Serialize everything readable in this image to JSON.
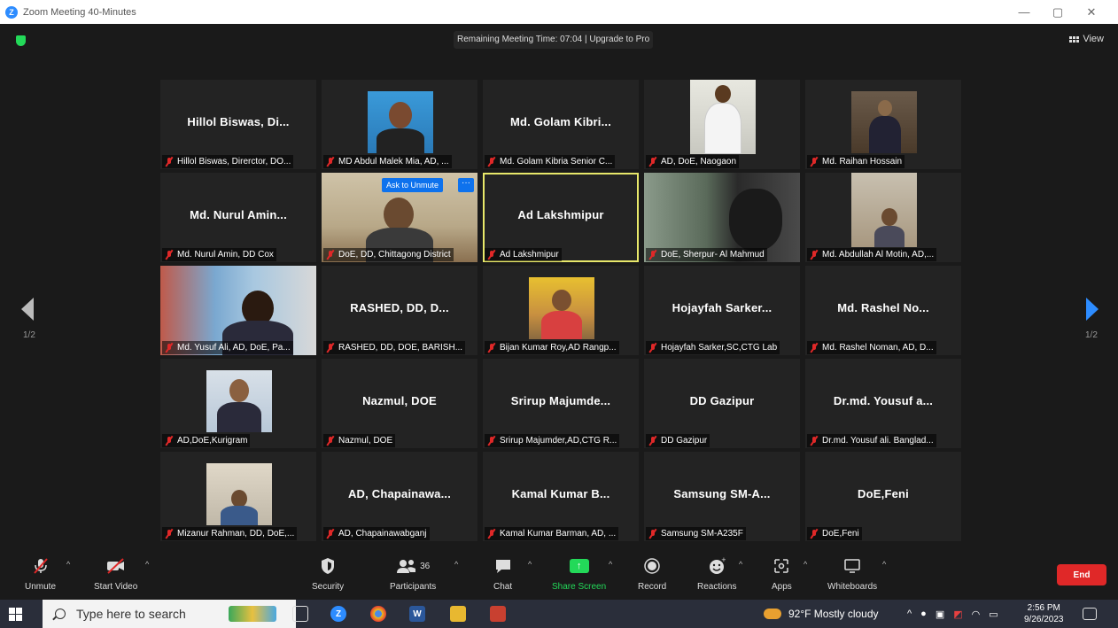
{
  "window": {
    "title": "Zoom Meeting 40-Minutes",
    "minimize": "—",
    "restore": "▢",
    "close": "✕"
  },
  "meeting": {
    "remaining": "Remaining Meeting Time: 07:04 | Upgrade to Pro",
    "view_label": "View",
    "page_left": "1/2",
    "page_right": "1/2",
    "ask_unmute": "Ask to Unmute",
    "more": "···"
  },
  "tiles": [
    {
      "big": "Hillol  Biswas,  Di...",
      "label": "Hillol Biswas, Direrctor, DO..."
    },
    {
      "big": "",
      "label": "MD Abdul Malek Mia, AD, ..."
    },
    {
      "big": "Md.  Golam  Kibri...",
      "label": "Md. Golam Kibria Senior C..."
    },
    {
      "big": "",
      "label": "AD, DoE, Naogaon"
    },
    {
      "big": "",
      "label": "Md. Raihan Hossain"
    },
    {
      "big": "Md.  Nurul  Amin...",
      "label": "Md. Nurul Amin, DD Cox"
    },
    {
      "big": "",
      "label": "DoE, DD, Chittagong District"
    },
    {
      "big": "Ad Lakshmipur",
      "label": "Ad Lakshmipur"
    },
    {
      "big": "",
      "label": "DoE, Sherpur- Al Mahmud"
    },
    {
      "big": "",
      "label": "Md. Abdullah Al Motin, AD,..."
    },
    {
      "big": "",
      "label": "Md. Yusuf Ali, AD, DoE, Pa..."
    },
    {
      "big": "RASHED,  DD,  D...",
      "label": "RASHED, DD, DOE, BARISH..."
    },
    {
      "big": "",
      "label": "Bijan Kumar Roy,AD Rangp..."
    },
    {
      "big": "Hojayfah  Sarker...",
      "label": "Hojayfah Sarker,SC,CTG Lab"
    },
    {
      "big": "Md.  Rashel  No...",
      "label": "Md. Rashel Noman, AD, D..."
    },
    {
      "big": "",
      "label": "AD,DoE,Kurigram"
    },
    {
      "big": "Nazmul,  DOE",
      "label": "Nazmul, DOE"
    },
    {
      "big": "Srirup  Majumde...",
      "label": "Srirup Majumder,AD,CTG R..."
    },
    {
      "big": "DD  Gazipur",
      "label": "DD Gazipur"
    },
    {
      "big": "Dr.md.  Yousuf  a...",
      "label": "Dr.md. Yousuf ali.  Banglad..."
    },
    {
      "big": "",
      "label": "Mizanur Rahman, DD, DoE,..."
    },
    {
      "big": "AD,  Chapainawa...",
      "label": "AD, Chapainawabganj"
    },
    {
      "big": "Kamal  Kumar  B...",
      "label": "Kamal Kumar Barman, AD, ..."
    },
    {
      "big": "Samsung  SM-A...",
      "label": "Samsung SM-A235F"
    },
    {
      "big": "DoE,Feni",
      "label": "DoE,Feni"
    }
  ],
  "toolbar": {
    "unmute": "Unmute",
    "start_video": "Start Video",
    "security": "Security",
    "participants": "Participants",
    "participants_count": "36",
    "chat": "Chat",
    "share_screen": "Share Screen",
    "record": "Record",
    "reactions": "Reactions",
    "apps": "Apps",
    "whiteboards": "Whiteboards",
    "end": "End",
    "caret": "^"
  },
  "taskbar": {
    "search_placeholder": "Type here to search",
    "weather": "92°F  Mostly cloudy",
    "time": "2:56 PM",
    "date": "9/26/2023"
  },
  "colors": {
    "accent_blue": "#2d8cff",
    "end_red": "#e02828",
    "share_green": "#23d959",
    "active_outline": "#e8e86a"
  }
}
